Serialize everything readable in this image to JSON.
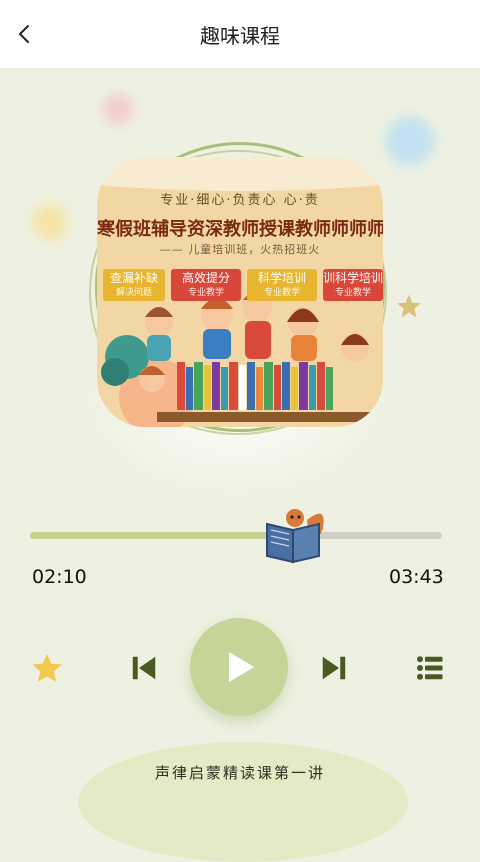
{
  "header": {
    "title": "趣味课程"
  },
  "cover": {
    "top_line": "专业·细心·负责心 心·责",
    "main_line": "寒假班辅导资深教师授课教师师师师",
    "sub_line": "—— 儿童培训班，火热招班火",
    "tags": [
      {
        "main": "查漏补缺",
        "sub": "解决问题"
      },
      {
        "main": "高效提分",
        "sub": "专业教学"
      },
      {
        "main": "科学培训",
        "sub": "专业教学"
      },
      {
        "main": "训科学培训",
        "sub": "专业教学"
      }
    ]
  },
  "player": {
    "progress": 0.64,
    "elapsed": "02:10",
    "duration": "03:43"
  },
  "controls": {
    "favorite_icon": "star-icon",
    "prev_icon": "skip-previous-icon",
    "play_icon": "play-icon",
    "next_icon": "skip-next-icon",
    "playlist_icon": "playlist-icon"
  },
  "lesson": {
    "title": "声律启蒙精读课第一讲"
  },
  "colors": {
    "background": "#eef1e1",
    "accent": "#c5d598",
    "control_green": "#4a5a22",
    "star_yellow": "#f2c94c"
  }
}
